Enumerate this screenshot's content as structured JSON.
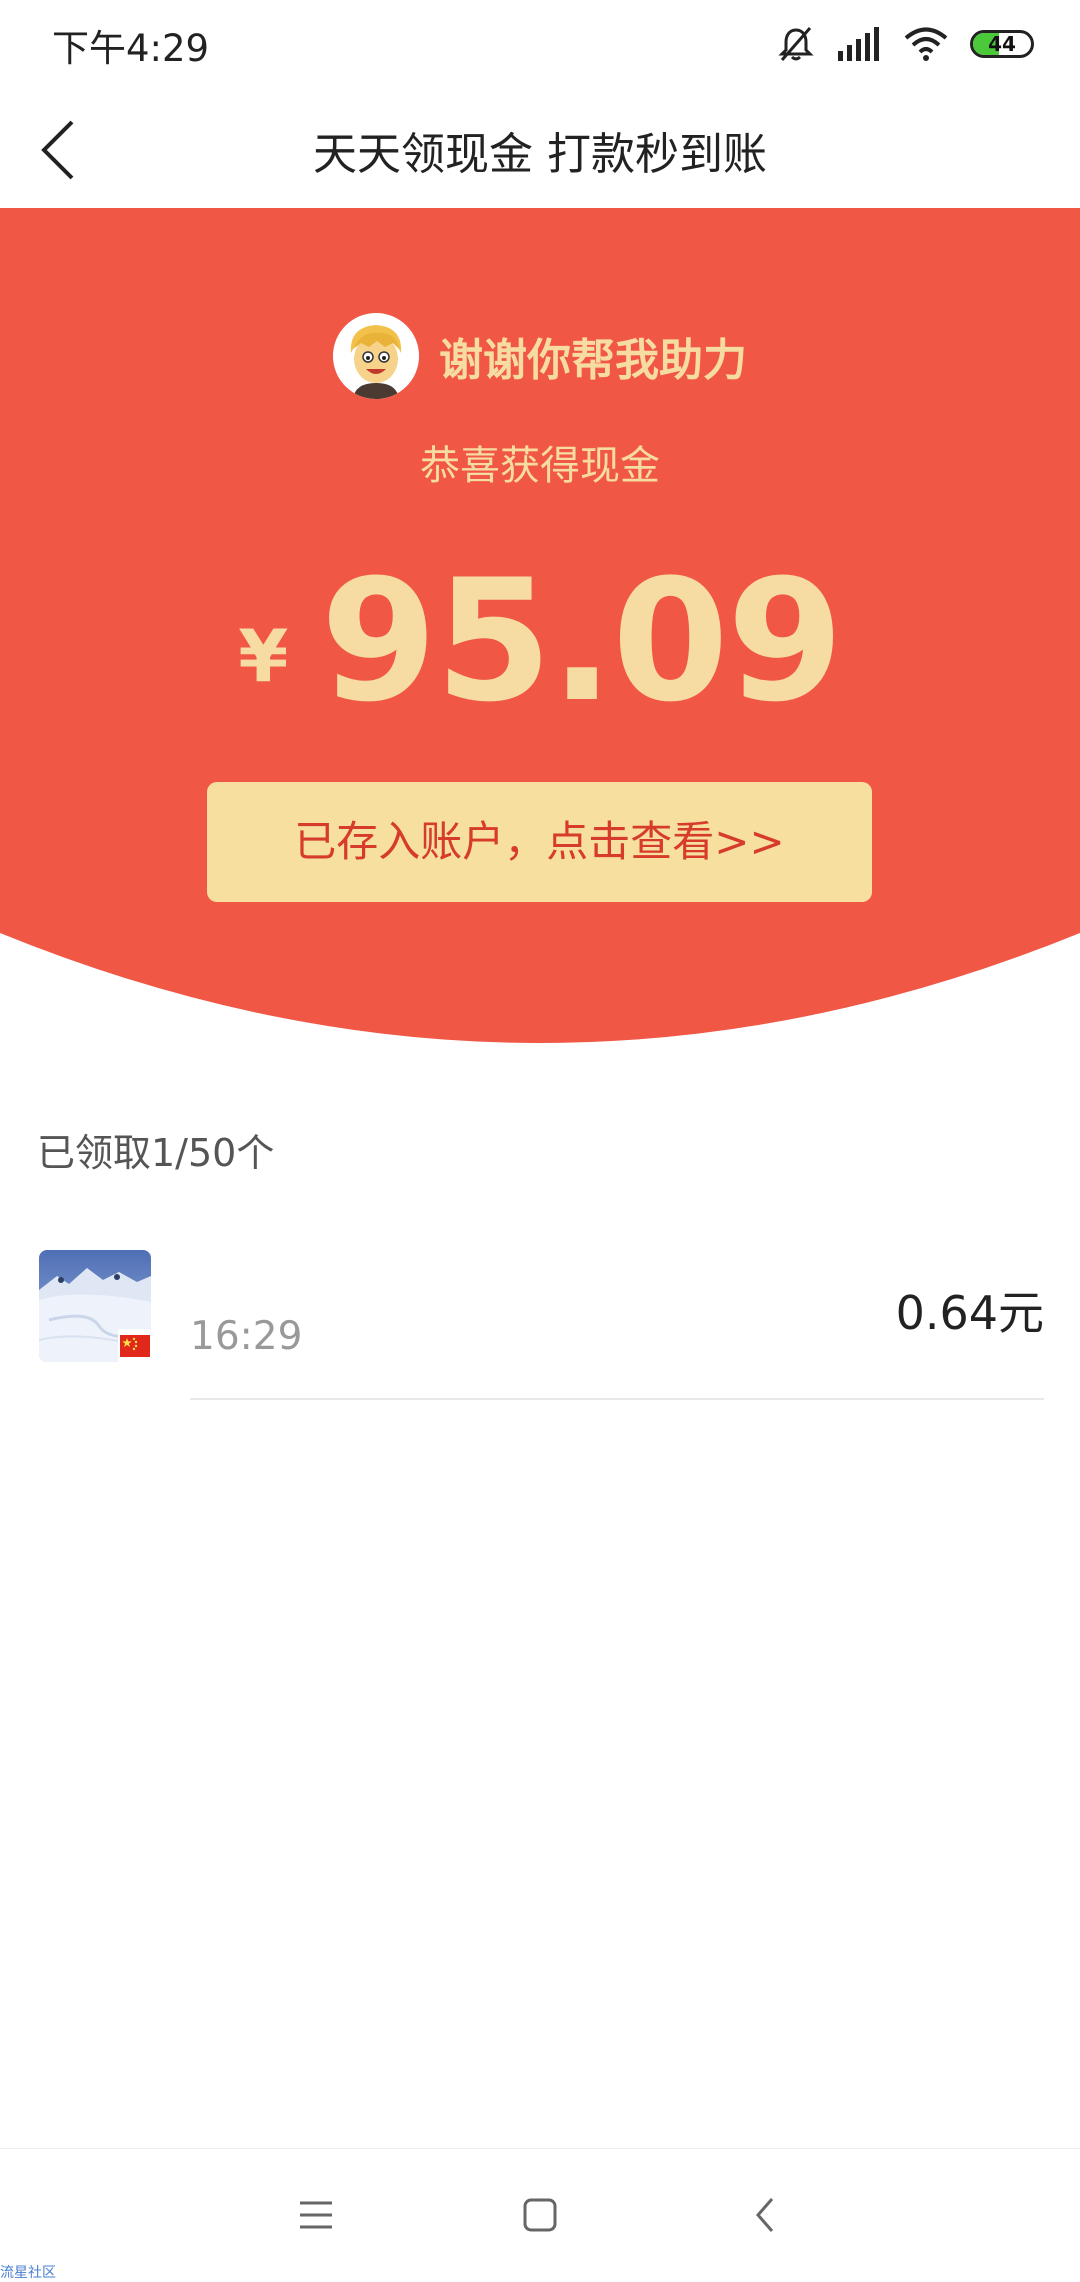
{
  "status_bar": {
    "time": "下午4:29",
    "battery": "44",
    "battery_level": 0.44,
    "icons": [
      "mute-icon",
      "signal-icon",
      "wifi-icon",
      "battery-icon"
    ]
  },
  "header": {
    "title": "天天领现金 打款秒到账",
    "back_icon": "chevron-left-icon"
  },
  "banner": {
    "helper_text": "谢谢你帮我助力",
    "subtitle": "恭喜获得现金",
    "currency": "¥",
    "amount": "95.09",
    "account_button": "已存入账户，点击查看>>",
    "bg_color": "#f15745",
    "accent_color": "#f6dca2"
  },
  "list": {
    "claimed_text": "已领取1/50个",
    "records": [
      {
        "time": "16:29",
        "amount": "0.64元"
      }
    ]
  },
  "nav_bar": {
    "icons": [
      "menu-icon",
      "home-icon",
      "back-icon"
    ]
  },
  "watermark": "流星社区"
}
